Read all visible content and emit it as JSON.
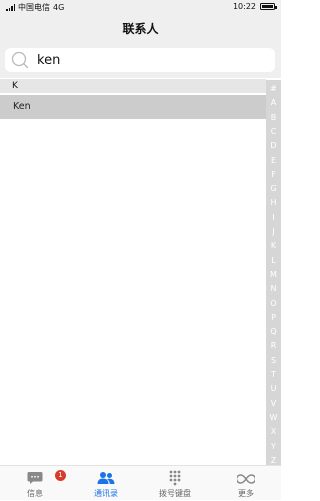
{
  "status_bar": {
    "carrier": "中国电信",
    "network": "4G",
    "time": "10:22"
  },
  "title": "联系人",
  "search": {
    "value": "ken",
    "icon": "search-icon"
  },
  "results": {
    "section_header": "K",
    "contacts": [
      "Ken"
    ]
  },
  "index_letters": [
    "#",
    "A",
    "B",
    "C",
    "D",
    "E",
    "F",
    "G",
    "H",
    "I",
    "J",
    "K",
    "L",
    "M",
    "N",
    "O",
    "P",
    "Q",
    "R",
    "S",
    "T",
    "U",
    "V",
    "W",
    "X",
    "Y",
    "Z"
  ],
  "tabs": [
    {
      "label": "信息",
      "icon": "message-icon",
      "badge": "1"
    },
    {
      "label": "通讯录",
      "icon": "contacts-icon",
      "active": true
    },
    {
      "label": "拨号键盘",
      "icon": "dialpad-icon"
    },
    {
      "label": "更多",
      "icon": "more-icon"
    }
  ],
  "colors": {
    "accent": "#1a73e8",
    "badge": "#d83b2b",
    "selected_row": "#cccccc",
    "index_bar": "#d6d6d6"
  }
}
